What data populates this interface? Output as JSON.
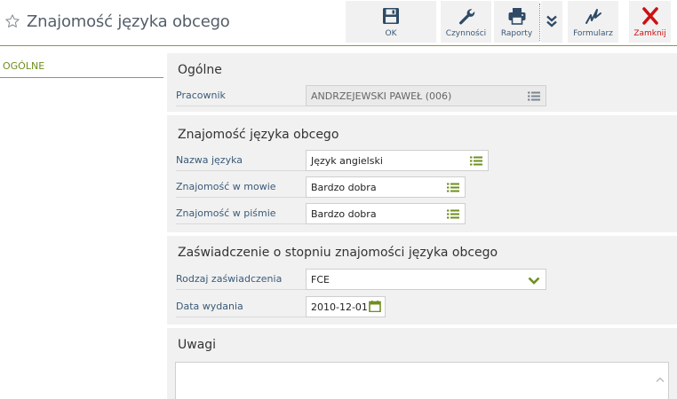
{
  "header": {
    "title": "Znajomość języka obcego"
  },
  "toolbar": {
    "ok_label": "OK",
    "actions_label": "Czynności",
    "reports_label": "Raporty",
    "form_label": "Formularz",
    "close_label": "Zamknij"
  },
  "nav": {
    "items": [
      {
        "label": "OGÓLNE"
      }
    ]
  },
  "sections": {
    "general": {
      "title": "Ogólne",
      "employee_label": "Pracownik",
      "employee_value": "ANDRZEJEWSKI PAWEŁ (006)"
    },
    "language": {
      "title": "Znajomość języka obcego",
      "name_label": "Nazwa języka",
      "name_value": "Język angielski",
      "speech_label": "Znajomość w mowie",
      "speech_value": "Bardzo dobra",
      "writing_label": "Znajomość w piśmie",
      "writing_value": "Bardzo dobra"
    },
    "certificate": {
      "title": "Zaświadczenie o stopniu znajomości języka obcego",
      "type_label": "Rodzaj zaświadczenia",
      "type_value": "FCE",
      "date_label": "Data wydania",
      "date_value": "2010-12-01"
    },
    "notes": {
      "title": "Uwagi",
      "value": ""
    }
  },
  "colors": {
    "accent_green": "#6f8f1f",
    "label_blue": "#3a5a78",
    "close_red": "#cc1111",
    "panel_bg": "#f1f1f1"
  },
  "icons": {
    "favorite": "star-outline-icon",
    "ok": "floppy-disk-icon",
    "actions": "wrench-icon",
    "reports": "printer-icon",
    "more": "double-chevron-down-icon",
    "form": "signature-icon",
    "close": "x-icon",
    "list": "list-icon",
    "dropdown": "chevron-down-icon",
    "calendar": "calendar-icon"
  }
}
